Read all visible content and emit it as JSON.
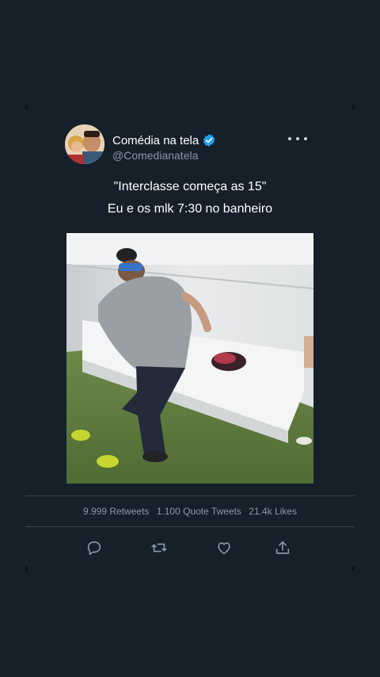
{
  "tweet": {
    "display_name": "Comédia na tela",
    "handle": "@Comedianatela",
    "verified": true,
    "text_line1": "\"Interclasse começa as 15\"",
    "text_line2": "Eu e os mlk 7:30 no banheiro"
  },
  "stats": {
    "retweets": "9.999 Retweets",
    "quotes": "1.100 Quote Tweets",
    "likes": "21.4k Likes"
  },
  "actions": [
    "reply-icon",
    "retweet-icon",
    "like-icon",
    "share-icon"
  ],
  "colors": {
    "background": "#15202b",
    "secondary_text": "#8899a6",
    "verified": "#1da1f2",
    "divider": "#38444d"
  }
}
